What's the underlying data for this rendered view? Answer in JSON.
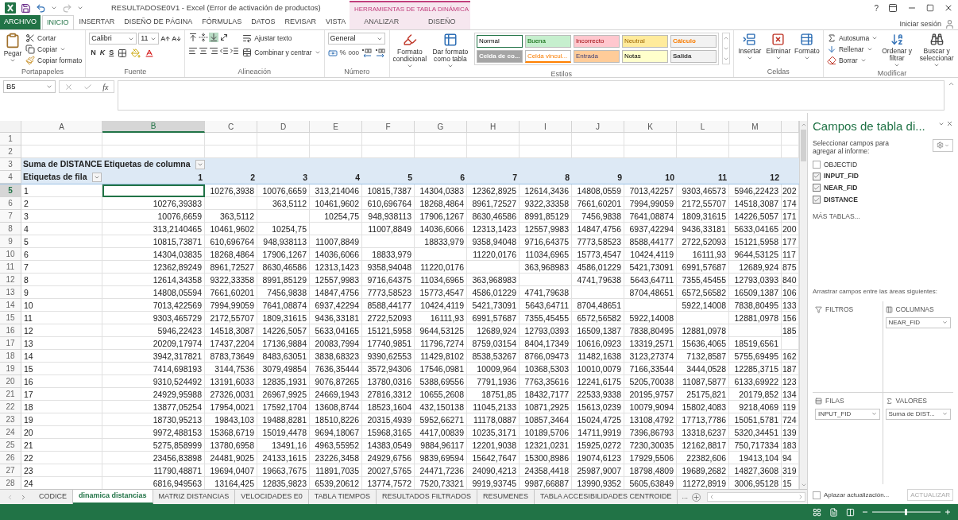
{
  "title_bar": {
    "title": "RESULTADOSE0V1 - Excel (Error de activación de productos)",
    "context_group": "HERRAMIENTAS DE TABLA DINÁMICA",
    "help": "?"
  },
  "ribbon_tabs": [
    {
      "label": "ARCHIVO",
      "kind": "file",
      "selected": false
    },
    {
      "label": "INICIO",
      "kind": "normal",
      "selected": true
    },
    {
      "label": "INSERTAR",
      "kind": "normal",
      "selected": false
    },
    {
      "label": "DISEÑO DE PÁGINA",
      "kind": "normal",
      "selected": false
    },
    {
      "label": "FÓRMULAS",
      "kind": "normal",
      "selected": false
    },
    {
      "label": "DATOS",
      "kind": "normal",
      "selected": false
    },
    {
      "label": "REVISAR",
      "kind": "normal",
      "selected": false
    },
    {
      "label": "VISTA",
      "kind": "normal",
      "selected": false
    },
    {
      "label": "ANALIZAR",
      "kind": "context",
      "selected": false
    },
    {
      "label": "DISEÑO",
      "kind": "context",
      "selected": false
    }
  ],
  "sign_in": "Iniciar sesión",
  "clipboard": {
    "paste": "Pegar",
    "cut": "Cortar",
    "copy": "Copiar",
    "format_painter": "Copiar formato",
    "group": "Portapapeles"
  },
  "font": {
    "name": "Calibri",
    "size": "11",
    "bold": "N",
    "italic": "K",
    "underline": "S",
    "group": "Fuente"
  },
  "alignment": {
    "wrap": "Ajustar texto",
    "merge": "Combinar y centrar",
    "group": "Alineación"
  },
  "number": {
    "format": "General",
    "percent": "%",
    "thousands": "000",
    "group": "Número"
  },
  "styles": {
    "conditional": "Formato condicional",
    "as_table": "Dar formato como tabla",
    "group": "Estilos",
    "items": [
      {
        "label": "Normal",
        "kind": "normal",
        "color": "#ffffff",
        "selected": true
      },
      {
        "label": "Buena",
        "kind": "good",
        "color": "#c6efce",
        "selected": false
      },
      {
        "label": "Incorrecto",
        "kind": "bad",
        "color": "#ffc7ce",
        "selected": false
      },
      {
        "label": "Neutral",
        "kind": "neutral",
        "color": "#ffeb9c",
        "selected": false
      },
      {
        "label": "Cálculo",
        "kind": "calculation",
        "color": "#f2f2f2",
        "selected": false
      },
      {
        "label": "Celda de co...",
        "kind": "check",
        "color": "#a5a5a5",
        "selected": false
      },
      {
        "label": "Celda vincul...",
        "kind": "linked",
        "color": "#ffffff",
        "selected": false
      },
      {
        "label": "Entrada",
        "kind": "input",
        "color": "#ffcc99",
        "selected": false
      },
      {
        "label": "Notas",
        "kind": "note",
        "color": "#ffffcc",
        "selected": false
      },
      {
        "label": "Salida",
        "kind": "output",
        "color": "#f2f2f2",
        "selected": false
      }
    ]
  },
  "cells_group": {
    "insert": "Insertar",
    "delete": "Eliminar",
    "format": "Formato",
    "group": "Celdas"
  },
  "editing": {
    "autosum": "Autosuma",
    "fill": "Rellenar",
    "clear": "Borrar",
    "sort": "Ordenar y filtrar",
    "find": "Buscar y seleccionar",
    "group": "Modificar"
  },
  "formula_bar": {
    "name_box": "B5",
    "function_label": "fx"
  },
  "grid": {
    "columns": [
      {
        "letter": "A",
        "selected": false
      },
      {
        "letter": "B",
        "selected": true
      },
      {
        "letter": "C",
        "selected": false
      },
      {
        "letter": "D",
        "selected": false
      },
      {
        "letter": "E",
        "selected": false
      },
      {
        "letter": "F",
        "selected": false
      },
      {
        "letter": "G",
        "selected": false
      },
      {
        "letter": "H",
        "selected": false
      },
      {
        "letter": "I",
        "selected": false
      },
      {
        "letter": "J",
        "selected": false
      },
      {
        "letter": "K",
        "selected": false
      },
      {
        "letter": "L",
        "selected": false
      },
      {
        "letter": "M",
        "selected": false
      }
    ],
    "empty_rows": [
      {
        "number": "1"
      },
      {
        "number": "2"
      }
    ],
    "pivot_header": {
      "number": "3",
      "value_label": "Suma de DISTANCE",
      "column_labels": "Etiquetas de columna"
    },
    "pivot_columns_row": {
      "number": "4",
      "row_labels": "Etiquetas de fila",
      "values": [
        "1",
        "2",
        "3",
        "4",
        "5",
        "6",
        "7",
        "8",
        "9",
        "10",
        "11",
        "12"
      ]
    },
    "rows": [
      {
        "number": "5",
        "selected": true,
        "cells": [
          "1",
          "",
          "10276,3938",
          "10076,6659",
          "313,214046",
          "10815,7387",
          "14304,0383",
          "12362,8925",
          "12614,3436",
          "14808,0559",
          "7013,42257",
          "9303,46573",
          "5946,22423",
          "202"
        ]
      },
      {
        "number": "6",
        "selected": false,
        "cells": [
          "2",
          "10276,39383",
          "",
          "363,5112",
          "10461,9602",
          "610,696764",
          "18268,4864",
          "8961,72527",
          "9322,33358",
          "7661,60201",
          "7994,99059",
          "2172,55707",
          "14518,3087",
          "174"
        ]
      },
      {
        "number": "7",
        "selected": false,
        "cells": [
          "3",
          "10076,6659",
          "363,5112",
          "",
          "10254,75",
          "948,938113",
          "17906,1267",
          "8630,46586",
          "8991,85129",
          "7456,9838",
          "7641,08874",
          "1809,31615",
          "14226,5057",
          "171"
        ]
      },
      {
        "number": "8",
        "selected": false,
        "cells": [
          "4",
          "313,2140465",
          "10461,9602",
          "10254,75",
          "",
          "11007,8849",
          "14036,6066",
          "12313,1423",
          "12557,9983",
          "14847,4756",
          "6937,42294",
          "9436,33181",
          "5633,04165",
          "200"
        ]
      },
      {
        "number": "9",
        "selected": false,
        "cells": [
          "5",
          "10815,73871",
          "610,696764",
          "948,938113",
          "11007,8849",
          "",
          "18833,979",
          "9358,94048",
          "9716,64375",
          "7773,58523",
          "8588,44177",
          "2722,52093",
          "15121,5958",
          "177"
        ]
      },
      {
        "number": "10",
        "selected": false,
        "cells": [
          "6",
          "14304,03835",
          "18268,4864",
          "17906,1267",
          "14036,6066",
          "18833,979",
          "",
          "11220,0176",
          "11034,6965",
          "15773,4547",
          "10424,4119",
          "16111,93",
          "9644,53125",
          "117"
        ]
      },
      {
        "number": "11",
        "selected": false,
        "cells": [
          "7",
          "12362,89249",
          "8961,72527",
          "8630,46586",
          "12313,1423",
          "9358,94048",
          "11220,0176",
          "",
          "363,968983",
          "4586,01229",
          "5421,73091",
          "6991,57687",
          "12689,924",
          "875"
        ]
      },
      {
        "number": "12",
        "selected": false,
        "cells": [
          "8",
          "12614,34358",
          "9322,33358",
          "8991,85129",
          "12557,9983",
          "9716,64375",
          "11034,6965",
          "363,968983",
          "",
          "4741,79638",
          "5643,64711",
          "7355,45455",
          "12793,0393",
          "840"
        ]
      },
      {
        "number": "13",
        "selected": false,
        "cells": [
          "9",
          "14808,05594",
          "7661,60201",
          "7456,9838",
          "14847,4756",
          "7773,58523",
          "15773,4547",
          "4586,01229",
          "4741,79638",
          "",
          "8704,48651",
          "6572,56582",
          "16509,1387",
          "106"
        ]
      },
      {
        "number": "14",
        "selected": false,
        "cells": [
          "10",
          "7013,422569",
          "7994,99059",
          "7641,08874",
          "6937,42294",
          "8588,44177",
          "10424,4119",
          "5421,73091",
          "5643,64711",
          "8704,48651",
          "",
          "5922,14008",
          "7838,80495",
          "133"
        ]
      },
      {
        "number": "15",
        "selected": false,
        "cells": [
          "11",
          "9303,465729",
          "2172,55707",
          "1809,31615",
          "9436,33181",
          "2722,52093",
          "16111,93",
          "6991,57687",
          "7355,45455",
          "6572,56582",
          "5922,14008",
          "",
          "12881,0978",
          "156"
        ]
      },
      {
        "number": "16",
        "selected": false,
        "cells": [
          "12",
          "5946,22423",
          "14518,3087",
          "14226,5057",
          "5633,04165",
          "15121,5958",
          "9644,53125",
          "12689,924",
          "12793,0393",
          "16509,1387",
          "7838,80495",
          "12881,0978",
          "",
          "185"
        ]
      },
      {
        "number": "17",
        "selected": false,
        "cells": [
          "13",
          "20209,17974",
          "17437,2204",
          "17136,9884",
          "20083,7994",
          "17740,9851",
          "11796,7274",
          "8759,03154",
          "8404,17349",
          "10616,0923",
          "13319,2571",
          "15636,4065",
          "18519,6561",
          ""
        ]
      },
      {
        "number": "18",
        "selected": false,
        "cells": [
          "14",
          "3942,317821",
          "8783,73649",
          "8483,63051",
          "3838,68323",
          "9390,62553",
          "11429,8102",
          "8538,53267",
          "8766,09473",
          "11482,1638",
          "3123,27374",
          "7132,8587",
          "5755,69495",
          "162"
        ]
      },
      {
        "number": "19",
        "selected": false,
        "cells": [
          "15",
          "7414,698193",
          "3144,7536",
          "3079,49854",
          "7636,35444",
          "3572,94306",
          "17546,0981",
          "10009,964",
          "10368,5303",
          "10010,0079",
          "7166,33544",
          "3444,0528",
          "12285,3715",
          "187"
        ]
      },
      {
        "number": "20",
        "selected": false,
        "cells": [
          "16",
          "9310,524492",
          "13191,6033",
          "12835,1931",
          "9076,87265",
          "13780,0316",
          "5388,69556",
          "7791,1936",
          "7763,35616",
          "12241,6175",
          "5205,70038",
          "11087,5877",
          "6133,69922",
          "123"
        ]
      },
      {
        "number": "21",
        "selected": false,
        "cells": [
          "17",
          "24929,95988",
          "27326,0031",
          "26967,9925",
          "24669,1943",
          "27816,3312",
          "10655,2608",
          "18751,85",
          "18432,7177",
          "22533,9338",
          "20195,9757",
          "25175,821",
          "20179,852",
          "134"
        ]
      },
      {
        "number": "22",
        "selected": false,
        "cells": [
          "18",
          "13877,05254",
          "17954,0021",
          "17592,1704",
          "13608,8744",
          "18523,1604",
          "432,150138",
          "11045,2133",
          "10871,2925",
          "15613,0239",
          "10079,9094",
          "15802,4083",
          "9218,4069",
          "119"
        ]
      },
      {
        "number": "23",
        "selected": false,
        "cells": [
          "19",
          "18730,95213",
          "19843,103",
          "19488,8281",
          "18510,8226",
          "20315,4939",
          "5952,66271",
          "11178,0887",
          "10857,3464",
          "15024,4725",
          "13108,4792",
          "17713,7786",
          "15051,5781",
          "724"
        ]
      },
      {
        "number": "24",
        "selected": false,
        "cells": [
          "20",
          "9972,488153",
          "15368,6719",
          "15019,4478",
          "9694,18067",
          "15968,3165",
          "4417,00839",
          "10235,3171",
          "10189,5706",
          "14711,9919",
          "7396,86793",
          "13318,6237",
          "5320,34451",
          "139"
        ]
      },
      {
        "number": "25",
        "selected": false,
        "cells": [
          "21",
          "5275,858999",
          "13780,6958",
          "13491,16",
          "4963,55952",
          "14383,0549",
          "9884,96117",
          "12201,9038",
          "12321,0231",
          "15925,0272",
          "7230,30035",
          "12162,8817",
          "750,717334",
          "183"
        ]
      },
      {
        "number": "26",
        "selected": false,
        "cells": [
          "22",
          "23456,83898",
          "24481,9025",
          "24133,1615",
          "23226,3458",
          "24929,6756",
          "9839,69594",
          "15642,7647",
          "15300,8986",
          "19074,6123",
          "17929,5506",
          "22382,606",
          "19413,104",
          "94"
        ]
      },
      {
        "number": "27",
        "selected": false,
        "cells": [
          "23",
          "11790,48871",
          "19694,0407",
          "19663,7675",
          "11891,7035",
          "20027,5765",
          "24471,7236",
          "24090,4213",
          "24358,4418",
          "25987,9007",
          "18798,4809",
          "19689,2682",
          "14827,3608",
          "319"
        ]
      },
      {
        "number": "28",
        "selected": false,
        "cells": [
          "24",
          "6816,949563",
          "13164,425",
          "12835,9823",
          "6539,20612",
          "13774,7572",
          "7520,73321",
          "9919,93745",
          "9987,66887",
          "13990,9352",
          "5605,63849",
          "11272,8919",
          "3006,95128",
          "15"
        ]
      }
    ]
  },
  "sheet_tabs": [
    {
      "label": "CODICE",
      "selected": false
    },
    {
      "label": "dinamica distancias",
      "selected": true
    },
    {
      "label": "MATRIZ DISTANCIAS",
      "selected": false
    },
    {
      "label": "VELOCIDADES E0",
      "selected": false
    },
    {
      "label": "TABLA TIEMPOS",
      "selected": false
    },
    {
      "label": "RESULTADOS FILTRADOS",
      "selected": false
    },
    {
      "label": "RESUMENES",
      "selected": false
    },
    {
      "label": "TABLA ACCESIBILIDADES CENTROIDE",
      "selected": false
    }
  ],
  "more_sheets": "...",
  "pivot_panel": {
    "title": "Campos de tabla di...",
    "instructions": "Seleccionar campos para agregar al informe:",
    "fields": [
      {
        "name": "OBJECTID",
        "checked": false
      },
      {
        "name": "INPUT_FID",
        "checked": true
      },
      {
        "name": "NEAR_FID",
        "checked": true
      },
      {
        "name": "DISTANCE",
        "checked": true
      }
    ],
    "more_tables": "MÁS TABLAS...",
    "drag_hint": "Arrastrar campos entre las áreas siguientes:",
    "areas": [
      {
        "kind": "filters",
        "label": "FILTROS"
      },
      {
        "kind": "columns",
        "label": "COLUMNAS",
        "items": [
          "NEAR_FID"
        ]
      },
      {
        "kind": "rows",
        "label": "FILAS",
        "items": [
          "INPUT_FID"
        ]
      },
      {
        "kind": "values",
        "label": "VALORES",
        "items": [
          "Suma de DIST..."
        ]
      }
    ],
    "defer": {
      "label": "Aplazar actualización...",
      "checked": false
    },
    "update": "ACTUALIZAR"
  }
}
